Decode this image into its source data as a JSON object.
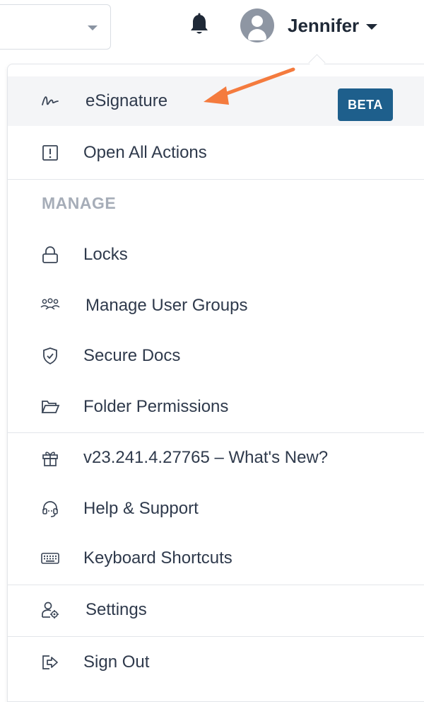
{
  "topbar": {
    "user_name": "Jennifer"
  },
  "menu": {
    "esignature": {
      "label": "eSignature",
      "badge": "BETA"
    },
    "open_all_actions": {
      "label": "Open All Actions"
    },
    "manage_section_title": "MANAGE",
    "locks": {
      "label": "Locks"
    },
    "manage_user_groups": {
      "label": "Manage User Groups"
    },
    "secure_docs": {
      "label": "Secure Docs"
    },
    "folder_permissions": {
      "label": "Folder Permissions"
    },
    "whats_new": {
      "label": "v23.241.4.27765 – What's New?"
    },
    "help_support": {
      "label": "Help & Support"
    },
    "keyboard_shortcuts": {
      "label": "Keyboard Shortcuts"
    },
    "settings": {
      "label": "Settings"
    },
    "sign_out": {
      "label": "Sign Out"
    }
  },
  "colors": {
    "accent_arrow": "#f47b3e",
    "beta_badge": "#1e5f8c",
    "highlight_row": "#f4f5f7",
    "section_title": "#a6adb8"
  },
  "icons": {
    "esignature": "signature-icon",
    "open_all_actions": "exclamation-box-icon",
    "locks": "lock-icon",
    "manage_user_groups": "users-group-icon",
    "secure_docs": "shield-check-icon",
    "folder_permissions": "folder-open-icon",
    "whats_new": "gift-icon",
    "help_support": "headset-icon",
    "keyboard_shortcuts": "keyboard-icon",
    "settings": "user-settings-icon",
    "sign_out": "sign-out-icon"
  }
}
